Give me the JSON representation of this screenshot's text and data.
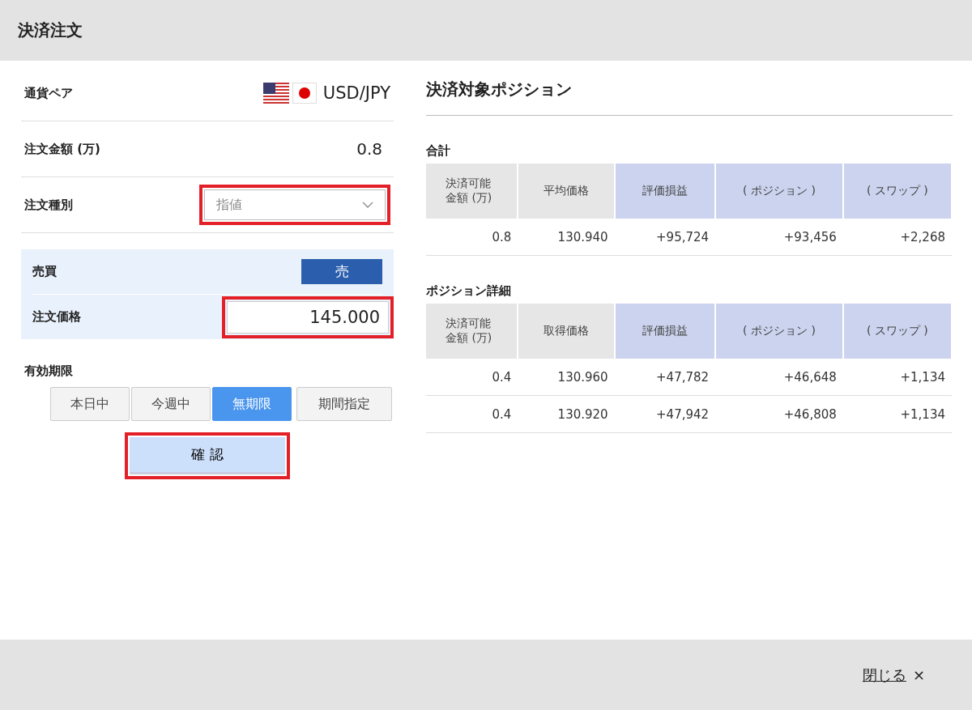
{
  "window": {
    "title": "決済注文"
  },
  "form": {
    "currency_pair": {
      "label": "通貨ペア",
      "value": "USD/JPY"
    },
    "amount": {
      "label": "注文金額 (万)",
      "value": "0.8"
    },
    "order_type": {
      "label": "注文種別",
      "value": "指値",
      "highlighted": true
    },
    "side": {
      "label": "売買",
      "value": "売"
    },
    "price": {
      "label": "注文価格",
      "value": "145.000",
      "highlighted": true
    },
    "expiry": {
      "label": "有効期限",
      "options": [
        {
          "label": "本日中",
          "selected": false
        },
        {
          "label": "今週中",
          "selected": false
        },
        {
          "label": "無期限",
          "selected": true
        },
        {
          "label": "期間指定",
          "selected": false
        }
      ]
    },
    "confirm_button": {
      "label": "確 認",
      "highlighted": true
    }
  },
  "positions": {
    "title": "決済対象ポジション",
    "tables": [
      {
        "title": "合計",
        "columns": [
          {
            "label": "決済可能金額 (万)",
            "kind": "base"
          },
          {
            "label": "平均価格",
            "kind": "base"
          },
          {
            "label": "評価損益",
            "kind": "pnl"
          },
          {
            "label": "( ポジション )",
            "kind": "pnl"
          },
          {
            "label": "( スワップ )",
            "kind": "pnl"
          }
        ],
        "rows": [
          [
            "0.8",
            "130.940",
            "+95,724",
            "+93,456",
            "+2,268"
          ]
        ]
      },
      {
        "title": "ポジション詳細",
        "columns": [
          {
            "label": "決済可能金額 (万)",
            "kind": "base"
          },
          {
            "label": "取得価格",
            "kind": "base"
          },
          {
            "label": "評価損益",
            "kind": "pnl"
          },
          {
            "label": "( ポジション )",
            "kind": "pnl"
          },
          {
            "label": "( スワップ )",
            "kind": "pnl"
          }
        ],
        "rows": [
          [
            "0.4",
            "130.960",
            "+47,782",
            "+46,648",
            "+1,134"
          ],
          [
            "0.4",
            "130.920",
            "+47,942",
            "+46,808",
            "+1,134"
          ]
        ]
      }
    ]
  },
  "footer": {
    "close_link": "閉じる",
    "close_icon": "×"
  }
}
